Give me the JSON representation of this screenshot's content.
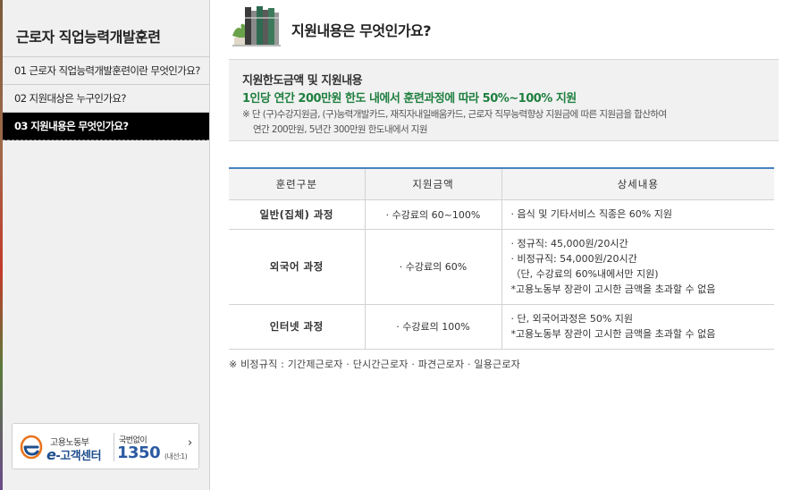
{
  "sidebar": {
    "title": "근로자 직업능력개발훈련",
    "items": [
      {
        "label": "01 근로자 직업능력개발훈련이란 무엇인가요?",
        "active": false
      },
      {
        "label": "02 지원대상은 누구인가요?",
        "active": false
      },
      {
        "label": "03 지원내용은 무엇인가요?",
        "active": true
      }
    ],
    "callcenter": {
      "org": "고용노동부",
      "name_e": "e",
      "name_rest": "-고객센터",
      "no_local": "국번없이",
      "number": "1350",
      "ext": "(내선:1)",
      "arrow": "›"
    }
  },
  "header": {
    "title": "지원내용은 무엇인가요?"
  },
  "info": {
    "heading": "지원한도금액 및 지원내용",
    "highlight": "1인당 연간 200만원 한도 내에서 훈련과정에 따라 50%~100% 지원",
    "note_line1": "※ 단 (구)수강지원금, (구)능력개발카드, 재직자내일배움카드, 근로자 직무능력향상 지원금에 따른 지원금을 합산하여",
    "note_line2": "연간 200만원, 5년간 300만원 한도내에서 지원"
  },
  "table": {
    "headers": [
      "훈련구분",
      "지원금액",
      "상세내용"
    ],
    "rows": [
      {
        "category": "일반(집체) 과정",
        "amount": "· 수강료의 60~100%",
        "details": [
          "· 음식 및 기타서비스 직종은 60% 지원"
        ]
      },
      {
        "category": "외국어 과정",
        "amount": "· 수강료의 60%",
        "details": [
          "· 정규직: 45,000원/20시간",
          "· 비정규직: 54,000원/20시간",
          "（단, 수강료의 60%내에서만 지원)",
          "*고용노동부 장관이 고시한 금액을 초과할 수 없음"
        ]
      },
      {
        "category": "인터넷 과정",
        "amount": "· 수강료의 100%",
        "details": [
          "· 단, 외국어과정은 50% 지원",
          "*고용노동부 장관이 고시한 금액을 초과할 수 없음"
        ]
      }
    ]
  },
  "footnote": "※ 비정규직 : 기간제근로자 · 단시간근로자 · 파견근로자 · 일용근로자",
  "colors": {
    "highlight_green": "#1f7f3f",
    "table_top_border": "#4a82c0",
    "active_menu_bg": "#000000"
  }
}
